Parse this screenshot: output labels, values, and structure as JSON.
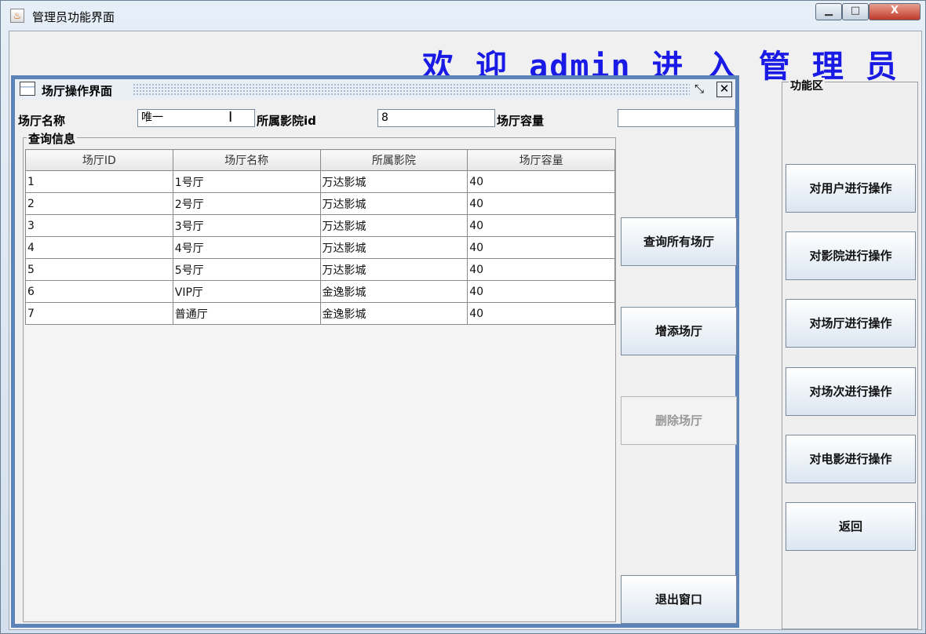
{
  "window": {
    "title": "管理员功能界面",
    "min_glyph": "▁",
    "max_glyph": "□",
    "close_glyph": "X"
  },
  "welcome": "欢 迎 admin 进 入 管 理 员",
  "function_area": {
    "title": "功能区",
    "buttons": [
      "对用户进行操作",
      "对影院进行操作",
      "对场厅进行操作",
      "对场次进行操作",
      "对电影进行操作",
      "返回"
    ]
  },
  "internal_frame": {
    "title": "场厅操作界面",
    "restore_glyph": "⤡",
    "close_glyph": "✕",
    "form": {
      "hall_name_label": "场厅名称",
      "hall_name_value": "唯一",
      "cinema_id_label": "所属影院id",
      "cinema_id_value": "8",
      "capacity_label": "场厅容量",
      "capacity_value": ""
    },
    "query_group_title": "查询信息",
    "table": {
      "headers": [
        "场厅ID",
        "场厅名称",
        "所属影院",
        "场厅容量"
      ],
      "rows": [
        [
          "1",
          "1号厅",
          "万达影城",
          "40"
        ],
        [
          "2",
          "2号厅",
          "万达影城",
          "40"
        ],
        [
          "3",
          "3号厅",
          "万达影城",
          "40"
        ],
        [
          "4",
          "4号厅",
          "万达影城",
          "40"
        ],
        [
          "5",
          "5号厅",
          "万达影城",
          "40"
        ],
        [
          "6",
          "VIP厅",
          "金逸影城",
          "40"
        ],
        [
          "7",
          "普通厅",
          "金逸影城",
          "40"
        ]
      ]
    },
    "actions": {
      "query_all": "查询所有场厅",
      "add": "增添场厅",
      "delete": "删除场厅",
      "exit": "退出窗口"
    }
  }
}
